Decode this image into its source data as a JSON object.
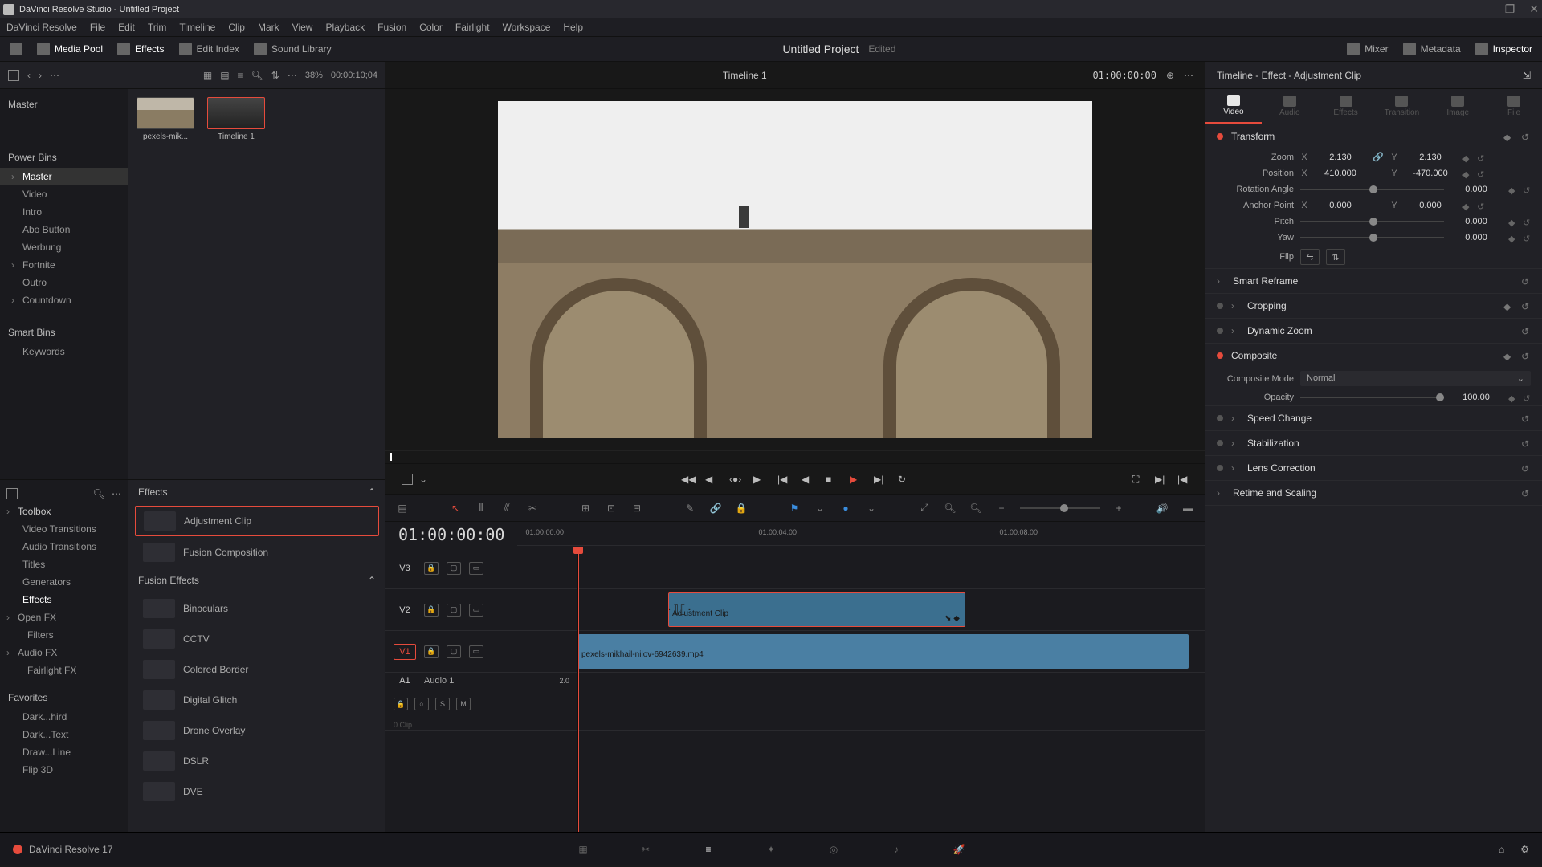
{
  "window": {
    "title": "DaVinci Resolve Studio - Untitled Project"
  },
  "menu": [
    "DaVinci Resolve",
    "File",
    "Edit",
    "Trim",
    "Timeline",
    "Clip",
    "Mark",
    "View",
    "Playback",
    "Fusion",
    "Color",
    "Fairlight",
    "Workspace",
    "Help"
  ],
  "toolbar": {
    "media_pool": "Media Pool",
    "effects": "Effects",
    "edit_index": "Edit Index",
    "sound_library": "Sound Library",
    "project_name": "Untitled Project",
    "edited": "Edited",
    "mixer": "Mixer",
    "metadata": "Metadata",
    "inspector": "Inspector"
  },
  "pool": {
    "zoom": "38%",
    "timecode": "00:00:10;04",
    "bins_header1": "Master",
    "bins_header2": "Power Bins",
    "bins_header3": "Smart Bins",
    "bins": [
      "Master",
      "Video",
      "Intro",
      "Abo Button",
      "Werbung",
      "Fortnite",
      "Outro",
      "Countdown"
    ],
    "smartbins": [
      "Keywords"
    ],
    "thumbs": [
      {
        "label": "pexels-mik..."
      },
      {
        "label": "Timeline 1"
      }
    ],
    "toolbox": "Toolbox",
    "fx_tree": [
      "Video Transitions",
      "Audio Transitions",
      "Titles",
      "Generators",
      "Effects"
    ],
    "openfx": "Open FX",
    "openfx_sub": [
      "Filters"
    ],
    "audiofx": "Audio FX",
    "audiofx_sub": [
      "Fairlight FX"
    ],
    "favorites": "Favorites",
    "fav_items": [
      "Dark...hird",
      "Dark...Text",
      "Draw...Line",
      "Flip 3D"
    ],
    "fx_hdr_effects": "Effects",
    "fx_items": [
      "Adjustment Clip",
      "Fusion Composition"
    ],
    "fx_hdr_fusion": "Fusion Effects",
    "fusion_items": [
      "Binoculars",
      "CCTV",
      "Colored Border",
      "Digital Glitch",
      "Drone Overlay",
      "DSLR",
      "DVE"
    ]
  },
  "viewer": {
    "timeline_name": "Timeline 1",
    "right_tc": "01:00:00:00"
  },
  "timeline": {
    "tc": "01:00:00:00",
    "ruler": [
      "01:00:00:00",
      "01:00:04:00",
      "01:00:08:00"
    ],
    "tracks": {
      "v3": "V3",
      "v2": "V2",
      "v1": "V1",
      "a1": "A1",
      "audio1": "Audio 1"
    },
    "audio_db": "2.0",
    "audio_clips": "0 Clip",
    "clip_adj": "Adjustment Clip",
    "clip_vid": "pexels-mikhail-nilov-6942639.mp4"
  },
  "inspector": {
    "header": "Timeline - Effect - Adjustment Clip",
    "tabs": [
      "Video",
      "Audio",
      "Effects",
      "Transition",
      "Image",
      "File"
    ],
    "transform": "Transform",
    "zoom_lbl": "Zoom",
    "zoom_x": "2.130",
    "zoom_y": "2.130",
    "pos_lbl": "Position",
    "pos_x": "410.000",
    "pos_y": "-470.000",
    "rot_lbl": "Rotation Angle",
    "rot_v": "0.000",
    "anchor_lbl": "Anchor Point",
    "anchor_x": "0.000",
    "anchor_y": "0.000",
    "pitch_lbl": "Pitch",
    "pitch_v": "0.000",
    "yaw_lbl": "Yaw",
    "yaw_v": "0.000",
    "flip_lbl": "Flip",
    "smart_reframe": "Smart Reframe",
    "cropping": "Cropping",
    "dyn_zoom": "Dynamic Zoom",
    "composite": "Composite",
    "comp_mode_lbl": "Composite Mode",
    "comp_mode": "Normal",
    "opacity_lbl": "Opacity",
    "opacity": "100.00",
    "speed": "Speed Change",
    "stab": "Stabilization",
    "lens": "Lens Correction",
    "retime": "Retime and Scaling"
  },
  "footer": {
    "version": "DaVinci Resolve 17"
  }
}
